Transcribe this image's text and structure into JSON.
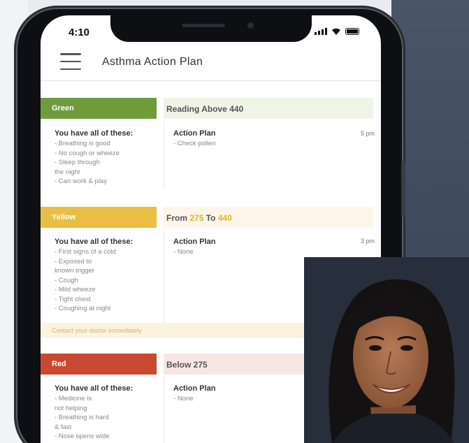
{
  "status": {
    "time": "4:10"
  },
  "header": {
    "title": "Asthma Action Plan",
    "menu_icon": "hamburger-menu-icon"
  },
  "zones": {
    "green": {
      "label": "Green",
      "banner": "Reading Above 440",
      "symptoms_title": "You have all of these:",
      "symptoms": [
        "- Breathing is good",
        "- No cough or wheeze",
        "- Sleep through",
        "  the night",
        "- Can work & play"
      ],
      "action_title": "Action Plan",
      "actions": [
        "- Check pollen"
      ],
      "time": "5 pm",
      "color": "#6f9c3b",
      "banner_bg": "#eff4e6"
    },
    "yellow": {
      "label": "Yellow",
      "banner_prefix": "From",
      "banner_from": "275",
      "banner_mid": "To",
      "banner_to": "440",
      "symptoms_title": "You have all of these:",
      "symptoms": [
        "- First signs of a cold",
        "- Exposed to",
        "  known trigger",
        "- Cough",
        "- Mild wheeze",
        "- Tight chest",
        "- Coughing at night"
      ],
      "action_title": "Action Plan",
      "actions": [
        "- None"
      ],
      "time": "3 pm",
      "color": "#eabd43",
      "banner_bg": "#fdf5e8",
      "note": "Contact your doctor immediately"
    },
    "red": {
      "label": "Red",
      "banner": "Below 275",
      "symptoms_title": "You have all of these:",
      "symptoms": [
        "- Medicine is",
        "  not helping",
        "- Breathing is hard",
        "  & fast",
        "- Nose opens wide"
      ],
      "action_title": "Action Plan",
      "actions": [
        "- None"
      ],
      "color": "#c9482f",
      "banner_bg": "#f7e6e4"
    }
  },
  "colors": {
    "background_right": "#46505f"
  }
}
